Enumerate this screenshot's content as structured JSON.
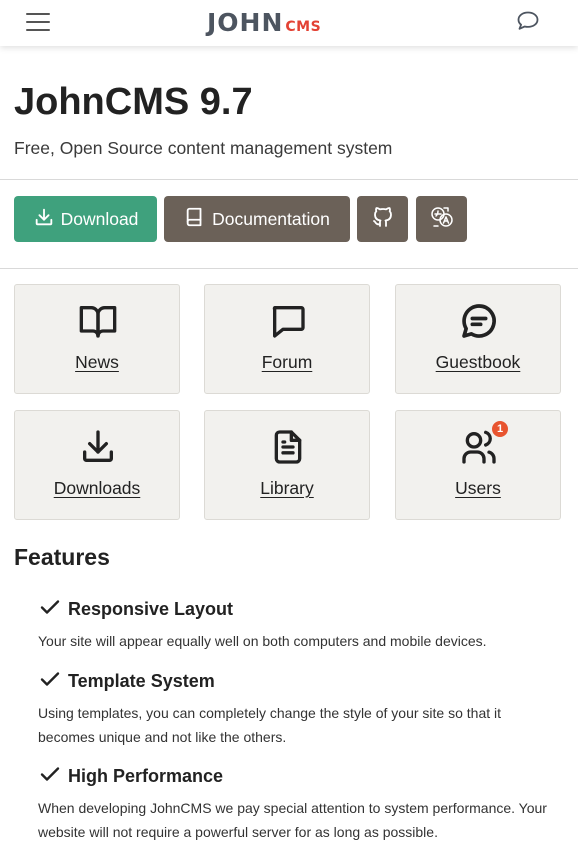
{
  "header": {
    "logo_main": "JOHN",
    "logo_sub": "CMS",
    "menu_icon": "hamburger-menu-icon",
    "chat_icon": "chat-bubble-icon"
  },
  "hero": {
    "title": "JohnCMS 9.7",
    "subtitle": "Free, Open Source content management system"
  },
  "actions": {
    "download_label": "Download",
    "documentation_label": "Documentation",
    "github_icon": "github-icon",
    "language_icon": "translate-icon"
  },
  "tiles": [
    {
      "label": "News",
      "icon": "book-open-icon"
    },
    {
      "label": "Forum",
      "icon": "message-square-icon"
    },
    {
      "label": "Guestbook",
      "icon": "message-circle-icon"
    },
    {
      "label": "Downloads",
      "icon": "download-icon"
    },
    {
      "label": "Library",
      "icon": "file-text-icon"
    },
    {
      "label": "Users",
      "icon": "users-icon",
      "badge": "1"
    }
  ],
  "features": {
    "title": "Features",
    "items": [
      {
        "title": "Responsive Layout",
        "description": "Your site will appear equally well on both computers and mobile devices."
      },
      {
        "title": "Template System",
        "description": "Using templates, you can completely change the style of your site so that it becomes unique and not like the others."
      },
      {
        "title": "High Performance",
        "description": "When developing JohnCMS we pay special attention to system performance. Your website will not require a powerful server for as long as possible."
      }
    ]
  },
  "colors": {
    "download_button": "#3fa17d",
    "secondary_button": "#6b6158",
    "tile_background": "#f2f1ee",
    "badge": "#e8542f",
    "logo_main": "#4d5560",
    "logo_sub": "#e34234"
  }
}
